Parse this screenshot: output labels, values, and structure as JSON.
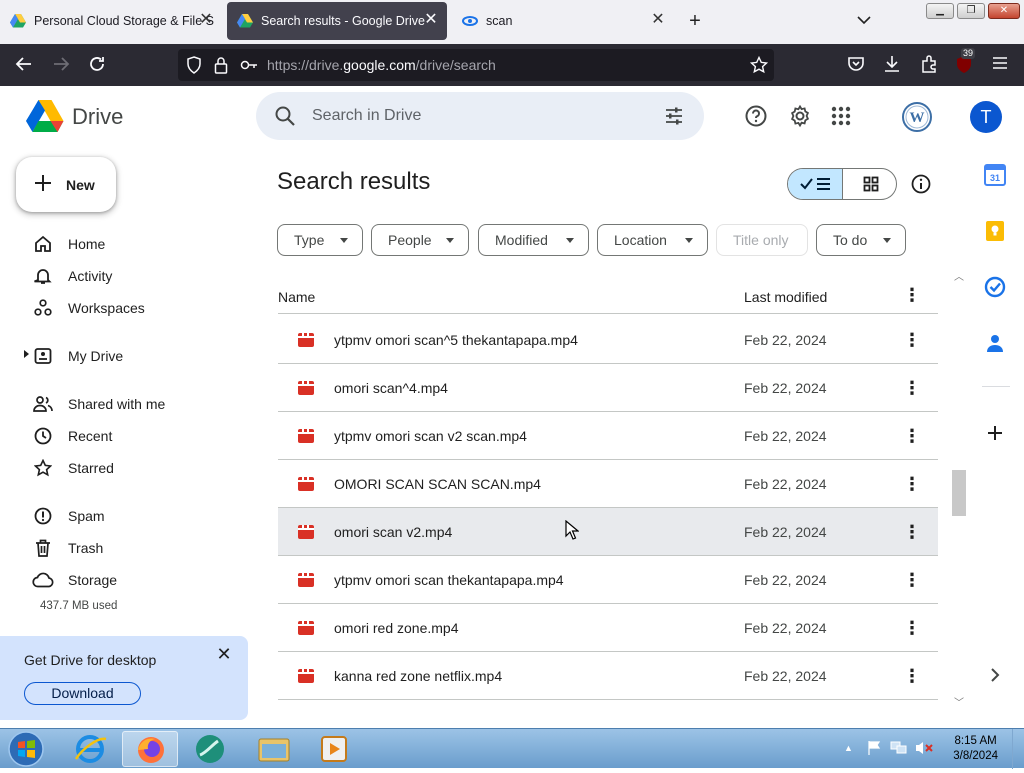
{
  "browser": {
    "tabs": [
      {
        "title": "Personal Cloud Storage & File S",
        "active": false
      },
      {
        "title": "Search results - Google Drive",
        "active": true
      },
      {
        "title": "scan",
        "active": false
      }
    ],
    "url": {
      "prefix": "https://drive.",
      "host": "google.com",
      "path": "/drive/search"
    },
    "extension_badge": "39"
  },
  "drive": {
    "logo_text": "Drive",
    "search_placeholder": "Search in Drive",
    "account_initial": "T",
    "new_label": "New",
    "nav": [
      {
        "label": "Home",
        "icon": "home-icon"
      },
      {
        "label": "Activity",
        "icon": "bell-icon"
      },
      {
        "label": "Workspaces",
        "icon": "workspaces-icon"
      },
      {
        "label": "My Drive",
        "icon": "my-drive-icon"
      },
      {
        "label": "Shared with me",
        "icon": "people-icon"
      },
      {
        "label": "Recent",
        "icon": "clock-icon"
      },
      {
        "label": "Starred",
        "icon": "star-icon"
      },
      {
        "label": "Spam",
        "icon": "spam-icon"
      },
      {
        "label": "Trash",
        "icon": "trash-icon"
      },
      {
        "label": "Storage",
        "icon": "cloud-icon"
      }
    ],
    "storage_used": "437.7 MB used",
    "promo": {
      "title": "Get Drive for desktop",
      "button": "Download"
    },
    "page_title": "Search results",
    "filters": [
      "Type",
      "People",
      "Modified",
      "Location",
      "Title only",
      "To do"
    ],
    "columns": {
      "name": "Name",
      "modified": "Last modified"
    },
    "files": [
      {
        "name": "ytpmv omori scan^5 thekantapapa.mp4",
        "modified": "Feb 22, 2024"
      },
      {
        "name": "omori scan^4.mp4",
        "modified": "Feb 22, 2024"
      },
      {
        "name": "ytpmv omori scan v2 scan.mp4",
        "modified": "Feb 22, 2024"
      },
      {
        "name": "OMORI SCAN SCAN SCAN.mp4",
        "modified": "Feb 22, 2024"
      },
      {
        "name": "omori scan v2.mp4",
        "modified": "Feb 22, 2024"
      },
      {
        "name": "ytpmv omori scan thekantapapa.mp4",
        "modified": "Feb 22, 2024"
      },
      {
        "name": "omori red zone.mp4",
        "modified": "Feb 22, 2024"
      },
      {
        "name": "kanna red zone netflix.mp4",
        "modified": "Feb 22, 2024"
      }
    ],
    "hovered_row": 4
  },
  "taskbar": {
    "time": "8:15 AM",
    "date": "3/8/2024"
  },
  "colors": {
    "accent": "#0b57d0",
    "selected_toggle": "#c2e7ff",
    "video_icon": "#d93025",
    "promo_bg": "#d3e3fd"
  }
}
